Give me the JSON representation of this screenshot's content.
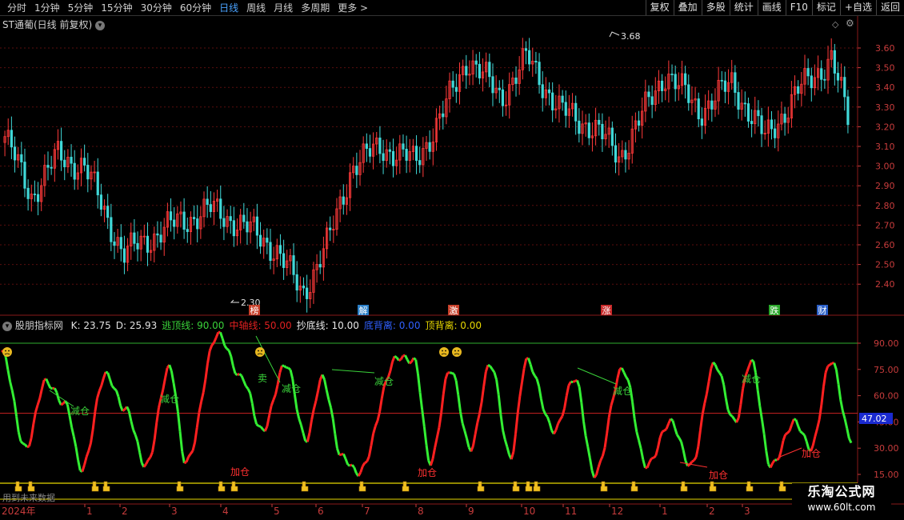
{
  "toolbar": {
    "periods": [
      "分时",
      "1分钟",
      "5分钟",
      "15分钟",
      "30分钟",
      "60分钟",
      "日线",
      "周线",
      "月线",
      "多周期",
      "更多 >"
    ],
    "active": "日线",
    "right_buttons": [
      "复权",
      "叠加",
      "多股",
      "统计",
      "画线",
      "F10",
      "标记",
      "+自选",
      "返回"
    ]
  },
  "main": {
    "title": "ST通葡(日线 前复权)",
    "price_ticks": [
      "3.60",
      "3.50",
      "3.40",
      "3.30",
      "3.20",
      "3.10",
      "3.00",
      "2.90",
      "2.80",
      "2.70",
      "2.60",
      "2.50",
      "2.40"
    ],
    "high_label": "3.68",
    "low_label": "2.30",
    "events": [
      "榜",
      "解",
      "激",
      "涨",
      "跌",
      "财"
    ]
  },
  "indicator": {
    "name": "股朋指标网",
    "values": [
      {
        "label": "K: 23.75",
        "color": "#e0e0e0"
      },
      {
        "label": "D: 25.93",
        "color": "#e0e0e0"
      },
      {
        "label": "逃顶线: 90.00",
        "color": "#3ad23a"
      },
      {
        "label": "中轴线: 50.00",
        "color": "#e02020"
      },
      {
        "label": "抄底线: 10.00",
        "color": "#e8e8e8"
      },
      {
        "label": "底背离: 0.00",
        "color": "#3060ff"
      },
      {
        "label": "顶背离: 0.00",
        "color": "#e8d800"
      }
    ],
    "y_ticks": [
      "90.00",
      "75.00",
      "60.00",
      "45.00",
      "30.00",
      "15.00"
    ],
    "current": "47.02",
    "signals": {
      "reduce": "减仓",
      "add": "加仓",
      "sell": "卖"
    },
    "note": "用到未来数据"
  },
  "x_axis": {
    "year": "2024年",
    "months": [
      "1",
      "2",
      "3",
      "4",
      "5",
      "6",
      "7",
      "8",
      "9",
      "10",
      "11",
      "12",
      "1",
      "2",
      "3"
    ]
  },
  "watermark": {
    "line1": "乐淘公式网",
    "line2": "www.60lt.com"
  },
  "colors": {
    "up": "#ff3a3a",
    "down": "#40d8d8",
    "kd_up": "#ff2020",
    "kd_down": "#33ee33",
    "axis": "#c83c3c"
  }
}
